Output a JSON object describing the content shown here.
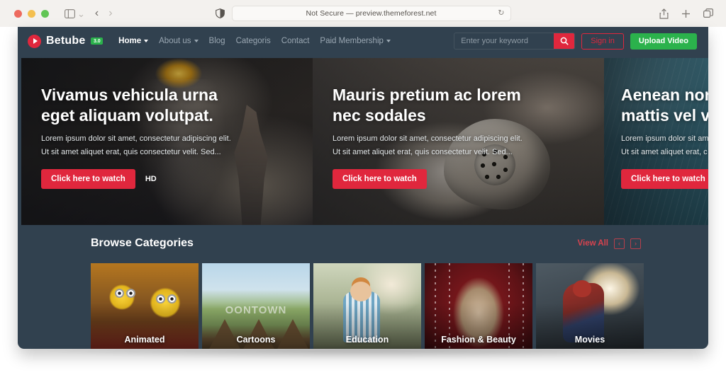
{
  "browser": {
    "address_label": "Not Secure — preview.themeforest.net",
    "icons": {
      "shield": "shield-icon",
      "reload": "reload-icon",
      "share": "share-icon",
      "new_tab": "plus-icon",
      "tabs_overview": "tabs-overview-icon",
      "sidebar_toggle": "sidebar-toggle-icon",
      "back": "back-arrow-icon",
      "forward": "forward-arrow-icon"
    },
    "back_glyph": "‹",
    "forward_glyph": "›",
    "chevron_glyph": "⌄",
    "reload_glyph": "↻"
  },
  "navbar": {
    "brand_name": "Betube",
    "brand_badge": "3.0",
    "links": [
      {
        "label": "Home",
        "has_caret": true,
        "active": true
      },
      {
        "label": "About us",
        "has_caret": true,
        "active": false
      },
      {
        "label": "Blog",
        "has_caret": false,
        "active": false
      },
      {
        "label": "Categoris",
        "has_caret": false,
        "active": false
      },
      {
        "label": "Contact",
        "has_caret": false,
        "active": false
      },
      {
        "label": "Paid Membership",
        "has_caret": true,
        "active": false
      }
    ],
    "search_placeholder": "Enter your keyword",
    "search_value": "",
    "signin_label": "Sign in",
    "upload_label": "Upload Video"
  },
  "hero": {
    "slides": [
      {
        "title": "Vivamus vehicula urna eget aliquam volutpat.",
        "desc_line1": "Lorem ipsum dolor sit amet, consectetur adipiscing elit.",
        "desc_line2": "Ut sit amet aliquet erat, quis consectetur velit. Sed...",
        "cta_label": "Click here to watch",
        "quality_badge": "HD"
      },
      {
        "title": "Mauris pretium ac lorem nec sodales",
        "desc_line1": "Lorem ipsum dolor sit amet, consectetur adipiscing elit.",
        "desc_line2": "Ut sit amet aliquet erat, quis consectetur velit. Sed...",
        "cta_label": "Click here to watch",
        "quality_badge": ""
      },
      {
        "title_line1": "Aenean non",
        "title_line2": "mattis vel v",
        "desc_line1": "Lorem ipsum dolor sit am",
        "desc_line2": "Ut sit amet aliquet erat, c",
        "cta_label": "Click here to watch"
      }
    ]
  },
  "categories": {
    "title": "Browse Categories",
    "view_all_label": "View All",
    "prev_glyph": "‹",
    "next_glyph": "›",
    "cards": [
      {
        "label": "Animated"
      },
      {
        "label": "Cartoons",
        "overlay_text": "OONTOWN"
      },
      {
        "label": "Education"
      },
      {
        "label": "Fashion & Beauty"
      },
      {
        "label": "Movies"
      }
    ]
  },
  "colors": {
    "page_bg": "#31414f",
    "accent_red": "#e0273d",
    "accent_green": "#2bb24c",
    "link_red": "#d8434f",
    "chrome_bg": "#f3f1ee"
  }
}
